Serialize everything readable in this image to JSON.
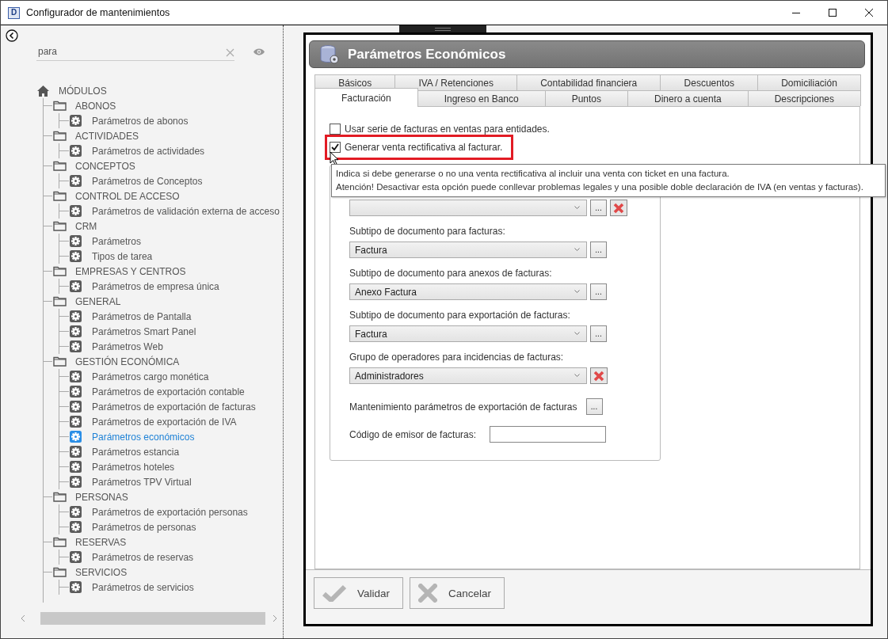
{
  "window": {
    "app_letter": "D",
    "title": "Configurador de mantenimientos"
  },
  "search": {
    "value": "para"
  },
  "tree": {
    "label": "MÓDULOS",
    "children": [
      {
        "label": "ABONOS",
        "children": [
          {
            "label": "Parámetros de abonos",
            "selected": false
          }
        ]
      },
      {
        "label": "ACTIVIDADES",
        "children": [
          {
            "label": "Parámetros de actividades",
            "selected": false
          }
        ]
      },
      {
        "label": "CONCEPTOS",
        "children": [
          {
            "label": "Parámetros de Conceptos",
            "selected": false
          }
        ]
      },
      {
        "label": "CONTROL DE ACCESO",
        "children": [
          {
            "label": "Parámetros de validación externa de acceso",
            "selected": false
          }
        ]
      },
      {
        "label": "CRM",
        "children": [
          {
            "label": "Parámetros",
            "selected": false
          },
          {
            "label": "Tipos de tarea",
            "selected": false
          }
        ]
      },
      {
        "label": "EMPRESAS Y CENTROS",
        "children": [
          {
            "label": "Parámetros de empresa única",
            "selected": false
          }
        ]
      },
      {
        "label": "GENERAL",
        "children": [
          {
            "label": "Parámetros de Pantalla",
            "selected": false
          },
          {
            "label": "Parámetros Smart Panel",
            "selected": false
          },
          {
            "label": "Parámetros Web",
            "selected": false
          }
        ]
      },
      {
        "label": "GESTIÓN ECONÓMICA",
        "children": [
          {
            "label": "Parámetros cargo monética",
            "selected": false
          },
          {
            "label": "Parámetros de exportación contable",
            "selected": false
          },
          {
            "label": "Parámetros de exportación de facturas",
            "selected": false
          },
          {
            "label": "Parámetros de exportación de IVA",
            "selected": false
          },
          {
            "label": "Parámetros económicos",
            "selected": true
          },
          {
            "label": "Parámetros estancia",
            "selected": false
          },
          {
            "label": "Parámetros hoteles",
            "selected": false
          },
          {
            "label": "Parámetros TPV Virtual",
            "selected": false
          }
        ]
      },
      {
        "label": "PERSONAS",
        "children": [
          {
            "label": "Parámetros de exportación personas",
            "selected": false
          },
          {
            "label": "Parámetros de personas",
            "selected": false
          }
        ]
      },
      {
        "label": "RESERVAS",
        "children": [
          {
            "label": "Parámetros de reservas",
            "selected": false
          }
        ]
      },
      {
        "label": "SERVICIOS",
        "children": [
          {
            "label": "Parámetros de servicios",
            "selected": false
          }
        ]
      }
    ]
  },
  "panel": {
    "title": "Parámetros Económicos",
    "tab_rows": [
      [
        {
          "label": "Básicos",
          "selected": false
        },
        {
          "label": "IVA / Retenciones",
          "selected": false
        },
        {
          "label": "Contabilidad financiera",
          "selected": false
        },
        {
          "label": "Descuentos",
          "selected": false
        },
        {
          "label": "Domiciliación",
          "selected": false
        }
      ],
      [
        {
          "label": "Facturación",
          "selected": true
        },
        {
          "label": "Ingreso en Banco",
          "selected": false
        },
        {
          "label": "Puntos",
          "selected": false
        },
        {
          "label": "Dinero a cuenta",
          "selected": false
        },
        {
          "label": "Descripciones",
          "selected": false
        }
      ]
    ],
    "checkboxes": [
      {
        "label": "Usar serie de facturas en ventas para entidades.",
        "checked": false,
        "highlighted": false
      },
      {
        "label": "Generar venta rectificativa al facturar.",
        "checked": true,
        "highlighted": true
      }
    ],
    "tooltip": [
      "Indica si debe generarse o no una venta rectificativa al incluir una venta con ticket en una factura.",
      "Atención! Desactivar esta opción puede conllevar problemas legales y una posible doble declaración de IVA (en ventas y facturas)."
    ],
    "fields": [
      {
        "kind": "combo",
        "actions": [
          {
            "kind": "browse",
            "label": "..."
          },
          {
            "kind": "clear"
          }
        ]
      },
      {
        "kind": "combo",
        "label": "Subtipo de documento para facturas:",
        "value": "Factura",
        "actions": [
          {
            "kind": "browse",
            "label": "..."
          }
        ]
      },
      {
        "kind": "combo",
        "label": "Subtipo de documento para anexos de facturas:",
        "value": "Anexo Factura",
        "actions": [
          {
            "kind": "browse",
            "label": "..."
          }
        ]
      },
      {
        "kind": "combo",
        "label": "Subtipo de documento para exportación de facturas:",
        "value": "Factura",
        "actions": [
          {
            "kind": "browse",
            "label": "..."
          }
        ]
      },
      {
        "kind": "combo",
        "label": "Grupo de operadores para incidencias de facturas:",
        "value": "Administradores",
        "actions": [
          {
            "kind": "clear"
          }
        ]
      },
      {
        "kind": "action",
        "label": "Mantenimiento parámetros de exportación de facturas",
        "actions": [
          {
            "kind": "browse",
            "label": "..."
          }
        ]
      },
      {
        "kind": "text",
        "label": "Código de emisor de facturas:"
      }
    ],
    "buttons": [
      {
        "kind": "validate",
        "label": "Validar"
      },
      {
        "kind": "cancel",
        "label": "Cancelar"
      }
    ]
  }
}
